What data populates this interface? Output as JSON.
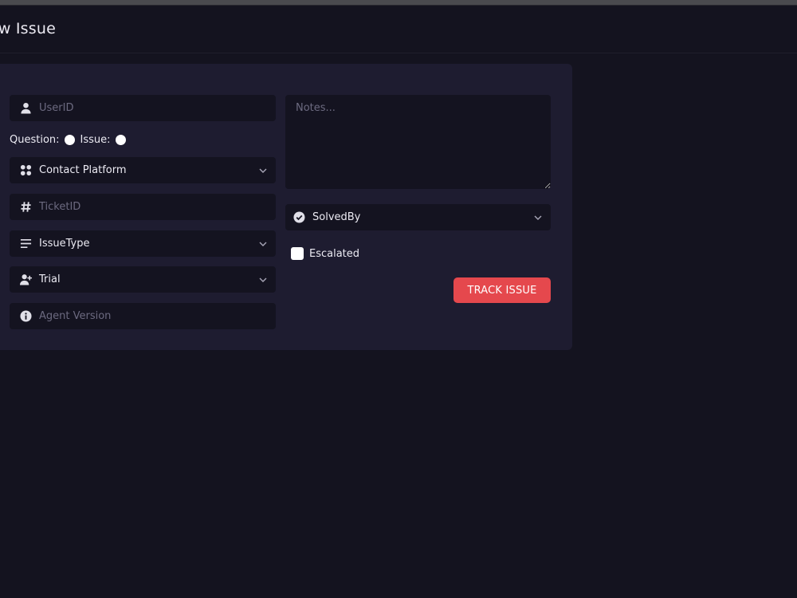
{
  "page": {
    "title": "ew Issue"
  },
  "form": {
    "user_id": {
      "placeholder": "UserID",
      "icon": "user-icon"
    },
    "type_choice": {
      "question_label": "Question:",
      "issue_label": "Issue:"
    },
    "contact_platform": {
      "label": "Contact Platform",
      "icon": "apps-icon"
    },
    "ticket_id": {
      "placeholder": "TicketID",
      "icon": "hash-icon"
    },
    "issue_type": {
      "label": "IssueType",
      "icon": "lines-icon"
    },
    "trial": {
      "label": "Trial",
      "icon": "user-plus-icon"
    },
    "agent_version": {
      "placeholder": "Agent Version",
      "icon": "info-icon"
    },
    "notes": {
      "placeholder": "Notes..."
    },
    "solved_by": {
      "label": "SolvedBy",
      "icon": "check-circle-icon"
    },
    "escalated": {
      "label": "Escalated"
    },
    "submit": {
      "label": "TRACK ISSUE"
    }
  },
  "colors": {
    "background": "#14131f",
    "card": "#1e1c30",
    "field": "#141320",
    "accent": "#e5484d"
  }
}
